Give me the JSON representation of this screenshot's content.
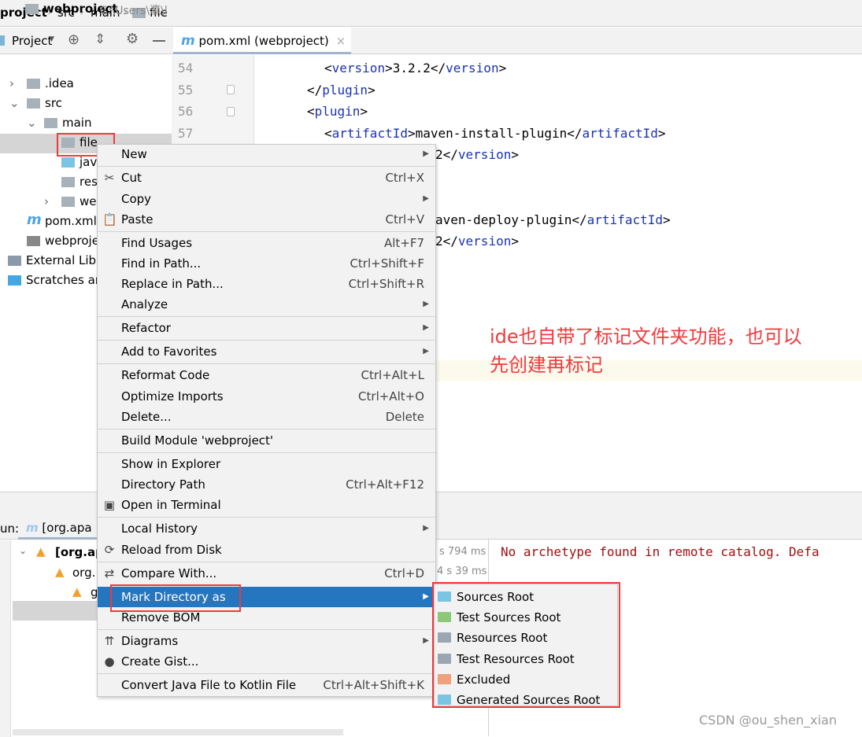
{
  "breadcrumb": [
    "project",
    "src",
    "main",
    "file"
  ],
  "toolwindow": {
    "title": "Project"
  },
  "editor": {
    "tab": "pom.xml (webproject)",
    "lines": [
      {
        "n": "54",
        "pre": "<",
        "tag": "version",
        "mid": ">3.2.2</",
        "tag2": "version",
        "post": ">"
      },
      {
        "n": "55",
        "pre": "</",
        "tag": "plugin",
        "post": ">"
      },
      {
        "n": "56",
        "pre": "<",
        "tag": "plugin",
        "post": ">"
      },
      {
        "n": "57",
        "pre": "<",
        "tag": "artifactId",
        "mid": ">maven-install-plugin</",
        "tag2": "artifactId",
        "post": ">"
      }
    ],
    "fragments": [
      {
        "mid": "2</",
        "tag2": "version",
        "post": ">"
      },
      {
        "mid": "aven-deploy-plugin</",
        "tag2": "artifactId",
        "post": ">"
      },
      {
        "mid": "2</",
        "tag2": "version",
        "post": ">"
      }
    ]
  },
  "tree": [
    {
      "label": "webproject",
      "extra": "C:\\Users\\瀛\\l",
      "icon": "module-folder-icon"
    },
    {
      "label": ".idea",
      "icon": "folder-icon"
    },
    {
      "label": "src",
      "icon": "folder-icon"
    },
    {
      "label": "main",
      "icon": "folder-icon"
    },
    {
      "label": "file",
      "icon": "folder-icon"
    },
    {
      "label": "java",
      "icon": "source-folder-icon"
    },
    {
      "label": "res",
      "icon": "resources-folder-icon"
    },
    {
      "label": "we",
      "icon": "web-folder-icon"
    },
    {
      "label": "pom.xml",
      "icon": "maven-icon"
    },
    {
      "label": "webproje",
      "icon": "iml-file-icon"
    },
    {
      "label": "External Libr",
      "icon": "libraries-icon"
    },
    {
      "label": "Scratches an",
      "icon": "scratches-icon"
    }
  ],
  "menu": [
    {
      "label": "New",
      "arrow": true
    },
    {
      "label": "Cut",
      "shortcut": "Ctrl+X",
      "icon": "scissors-icon",
      "glyph": "✂"
    },
    {
      "label": "Copy",
      "arrow": true
    },
    {
      "label": "Paste",
      "shortcut": "Ctrl+V",
      "icon": "clipboard-icon",
      "glyph": "📋"
    },
    {
      "label": "Find Usages",
      "shortcut": "Alt+F7"
    },
    {
      "label": "Find in Path...",
      "shortcut": "Ctrl+Shift+F"
    },
    {
      "label": "Replace in Path...",
      "shortcut": "Ctrl+Shift+R"
    },
    {
      "label": "Analyze",
      "arrow": true
    },
    {
      "label": "Refactor",
      "arrow": true
    },
    {
      "label": "Add to Favorites",
      "arrow": true
    },
    {
      "label": "Reformat Code",
      "shortcut": "Ctrl+Alt+L"
    },
    {
      "label": "Optimize Imports",
      "shortcut": "Ctrl+Alt+O"
    },
    {
      "label": "Delete...",
      "shortcut": "Delete"
    },
    {
      "label": "Build Module 'webproject'"
    },
    {
      "label": "Show in Explorer"
    },
    {
      "label": "Directory Path",
      "shortcut": "Ctrl+Alt+F12"
    },
    {
      "label": "Open in Terminal",
      "icon": "terminal-icon",
      "glyph": "▣"
    },
    {
      "label": "Local History",
      "arrow": true
    },
    {
      "label": "Reload from Disk",
      "icon": "reload-icon",
      "glyph": "⟳"
    },
    {
      "label": "Compare With...",
      "shortcut": "Ctrl+D",
      "icon": "compare-icon",
      "glyph": "⇄"
    },
    {
      "label": "Mark Directory as",
      "arrow": true,
      "selected": true
    },
    {
      "label": "Remove BOM"
    },
    {
      "label": "Diagrams",
      "arrow": true,
      "icon": "diagram-icon",
      "glyph": "⇈"
    },
    {
      "label": "Create Gist...",
      "icon": "github-icon",
      "glyph": "●"
    },
    {
      "label": "Convert Java File to Kotlin File",
      "shortcut": "Ctrl+Alt+Shift+K"
    }
  ],
  "submenu": [
    {
      "label": "Sources Root",
      "color": "#7cc4e4"
    },
    {
      "label": "Test Sources Root",
      "color": "#8cc878"
    },
    {
      "label": "Resources Root",
      "color": "#9aa7b0"
    },
    {
      "label": "Test Resources Root",
      "color": "#9aa7b0"
    },
    {
      "label": "Excluded",
      "color": "#f0a07a"
    },
    {
      "label": "Generated Sources Root",
      "color": "#7cc4e4"
    }
  ],
  "annotation": [
    "ide也自带了标记文件夹功能，也可以",
    "先创建再标记"
  ],
  "run": {
    "label": "un:",
    "tab": "[org.apa",
    "nodes": [
      "[org.ap",
      "org.",
      "g"
    ],
    "times": [
      "s 794 ms",
      "4 s 39 ms"
    ],
    "console": "No archetype found in remote catalog. Defa"
  },
  "watermark": "CSDN @ou_shen_xian",
  "colors": {
    "selection": "#2675bf",
    "highlight": "#f0393c",
    "tag": "#1a32b4"
  }
}
